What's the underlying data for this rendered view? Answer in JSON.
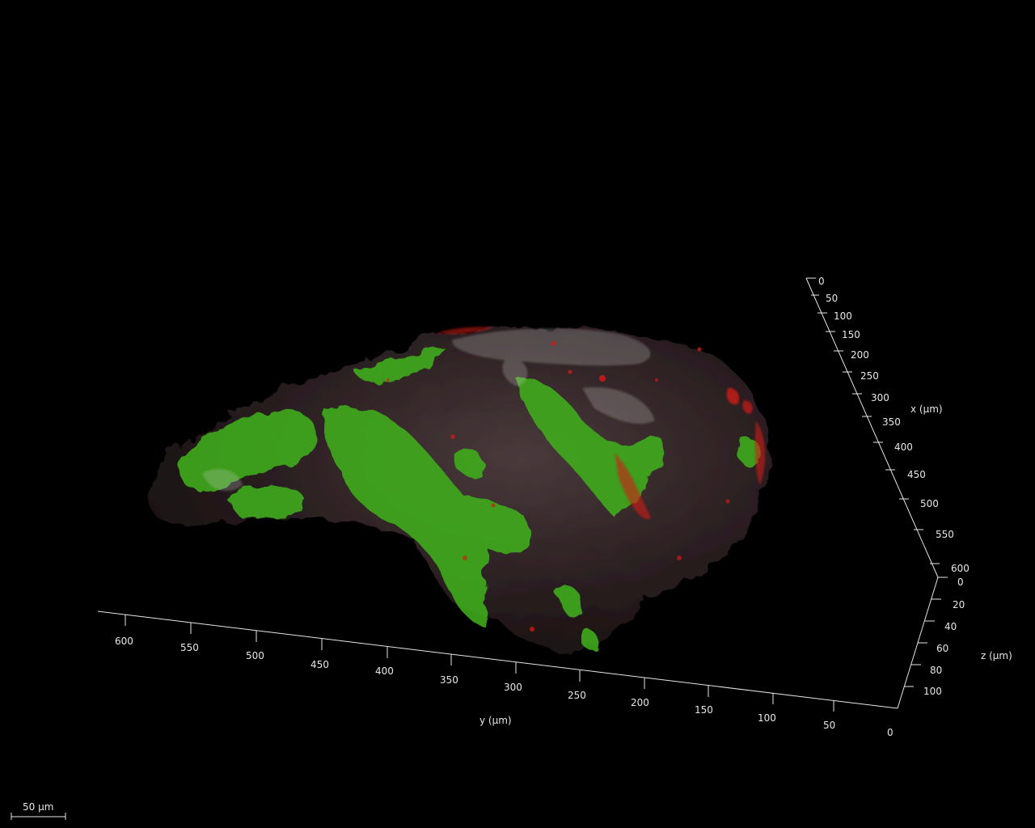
{
  "volume_render": {
    "subject": "3D confocal volume rendering of a tissue sample",
    "channels": [
      {
        "color": "#3fae1e"
      },
      {
        "color": "#d01a14"
      },
      {
        "color": "#cfcfcf"
      }
    ],
    "background": "#000000"
  },
  "axes": {
    "x": {
      "title": "x (µm)",
      "ticks": [
        "0",
        "50",
        "100",
        "150",
        "200",
        "250",
        "300",
        "350",
        "400",
        "450",
        "500",
        "550",
        "600"
      ]
    },
    "y": {
      "title": "y (µm)",
      "ticks": [
        "600",
        "550",
        "500",
        "450",
        "400",
        "350",
        "300",
        "250",
        "200",
        "150",
        "100",
        "50",
        "0"
      ]
    },
    "z": {
      "title": "z (µm)",
      "ticks": [
        "0",
        "20",
        "40",
        "60",
        "80",
        "100"
      ]
    }
  },
  "scale_bar": {
    "label": "50 µm"
  }
}
